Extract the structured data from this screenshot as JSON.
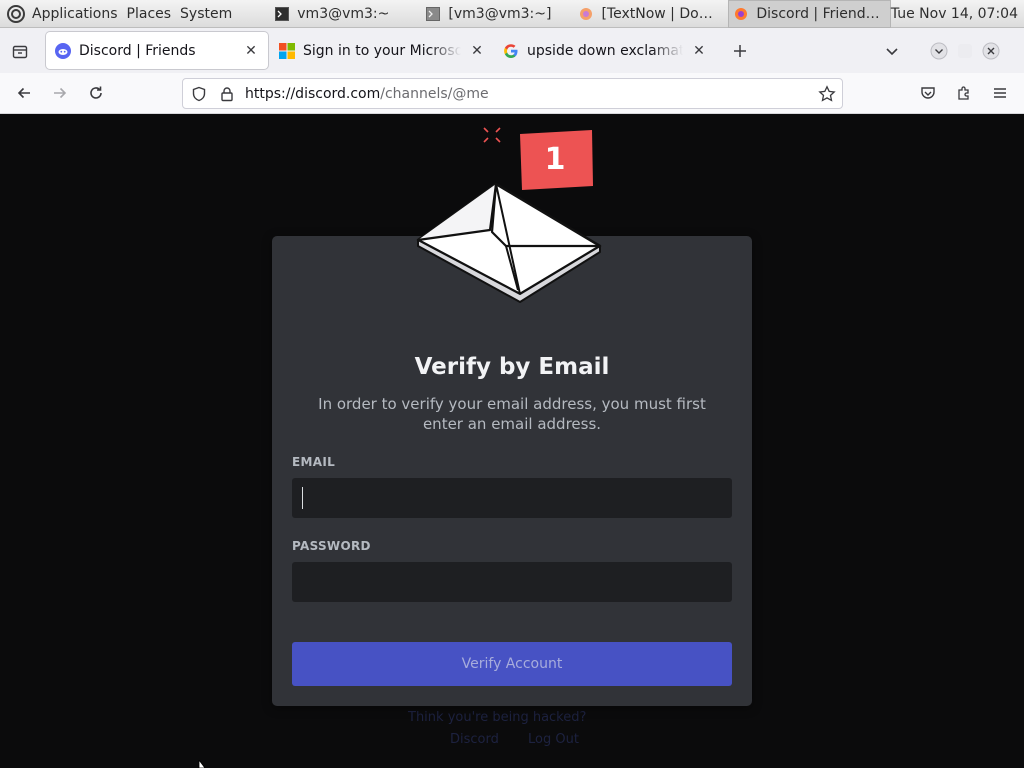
{
  "panel": {
    "menus": [
      "Applications",
      "Places",
      "System"
    ],
    "tasks": [
      {
        "label": "vm3@vm3:~"
      },
      {
        "label": "[vm3@vm3:~]"
      },
      {
        "label": "[TextNow | Downlo..."
      },
      {
        "label": "Discord | Friends — ..."
      }
    ],
    "clock": "Tue Nov 14, 07:04"
  },
  "tabs": [
    {
      "title": "Discord | Friends"
    },
    {
      "title": "Sign in to your Microsoft acco"
    },
    {
      "title": "upside down exclamation po"
    }
  ],
  "urlbar": {
    "host": "https://discord.com",
    "path": "/channels/@me"
  },
  "notification": {
    "count": "1"
  },
  "verify": {
    "title": "Verify by Email",
    "subtitle": "In order to verify your email address, you must first enter an email address.",
    "email_label": "EMAIL",
    "email_value": "",
    "password_label": "PASSWORD",
    "password_value": "",
    "button_label": "Verify Account"
  },
  "below_card": {
    "prompt": "Think you're being hacked?",
    "link_left": "Discord",
    "link_right": "Log Out"
  },
  "colors": {
    "discord_blurple": "#5865f2",
    "badge_red": "#ed5353",
    "card_bg": "#313338"
  }
}
